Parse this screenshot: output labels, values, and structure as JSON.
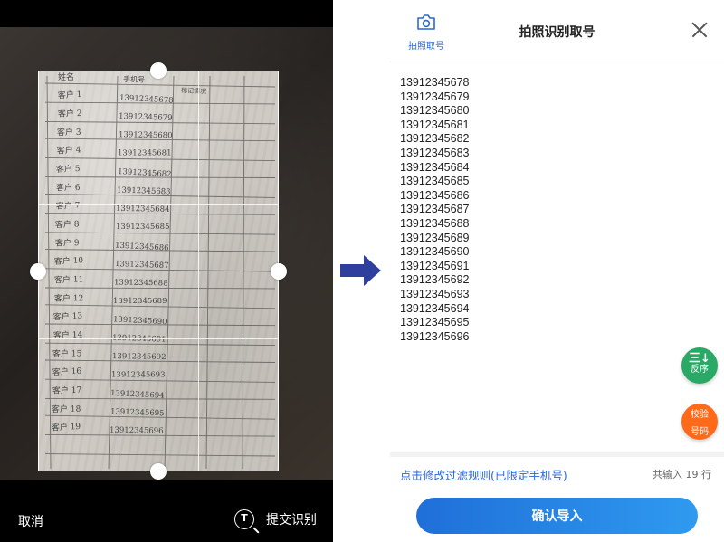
{
  "crop_screen": {
    "sheet": {
      "header_name": "姓名",
      "header_phone": "手机号",
      "header_note": "标记情况",
      "rows": [
        {
          "customer": "客户 1",
          "phone": "13912345678"
        },
        {
          "customer": "客户 2",
          "phone": "13912345679"
        },
        {
          "customer": "客户 3",
          "phone": "13912345680"
        },
        {
          "customer": "客户 4",
          "phone": "13912345681"
        },
        {
          "customer": "客户 5",
          "phone": "13912345682"
        },
        {
          "customer": "客户 6",
          "phone": "13912345683"
        },
        {
          "customer": "客户 7",
          "phone": "13912345684"
        },
        {
          "customer": "客户 8",
          "phone": "13912345685"
        },
        {
          "customer": "客户 9",
          "phone": "13912345686"
        },
        {
          "customer": "客户 10",
          "phone": "13912345687"
        },
        {
          "customer": "客户 11",
          "phone": "13912345688"
        },
        {
          "customer": "客户 12",
          "phone": "13912345689"
        },
        {
          "customer": "客户 13",
          "phone": "13912345690"
        },
        {
          "customer": "客户 14",
          "phone": "13912345691"
        },
        {
          "customer": "客户 15",
          "phone": "13912345692"
        },
        {
          "customer": "客户 16",
          "phone": "13912345693"
        },
        {
          "customer": "客户 17",
          "phone": "13912345694"
        },
        {
          "customer": "客户 18",
          "phone": "13912345695"
        },
        {
          "customer": "客户 19",
          "phone": "13912345696"
        }
      ]
    },
    "cancel_label": "取消",
    "submit_label": "提交识别",
    "submit_icon_letter": "T"
  },
  "app": {
    "header": {
      "camera_label": "拍照取号",
      "title": "拍照识别取号"
    },
    "numbers": [
      "13912345678",
      "13912345679",
      "13912345680",
      "13912345681",
      "13912345682",
      "13912345683",
      "13912345684",
      "13912345685",
      "13912345686",
      "13912345687",
      "13912345688",
      "13912345689",
      "13912345690",
      "13912345691",
      "13912345692",
      "13912345693",
      "13912345694",
      "13912345695",
      "13912345696"
    ],
    "fab_reverse": {
      "glyph": "三↓",
      "label": "反序",
      "color": "#2aa865"
    },
    "fab_check": {
      "line1": "校验",
      "line2": "号码",
      "color": "#ff6a1a"
    },
    "filter_link": "点击修改过滤规则(已限定手机号)",
    "count_text": "共输入 19 行",
    "confirm_label": "确认导入",
    "accent_color": "#2a67d9"
  },
  "arrow_color": "#2f3f9e"
}
